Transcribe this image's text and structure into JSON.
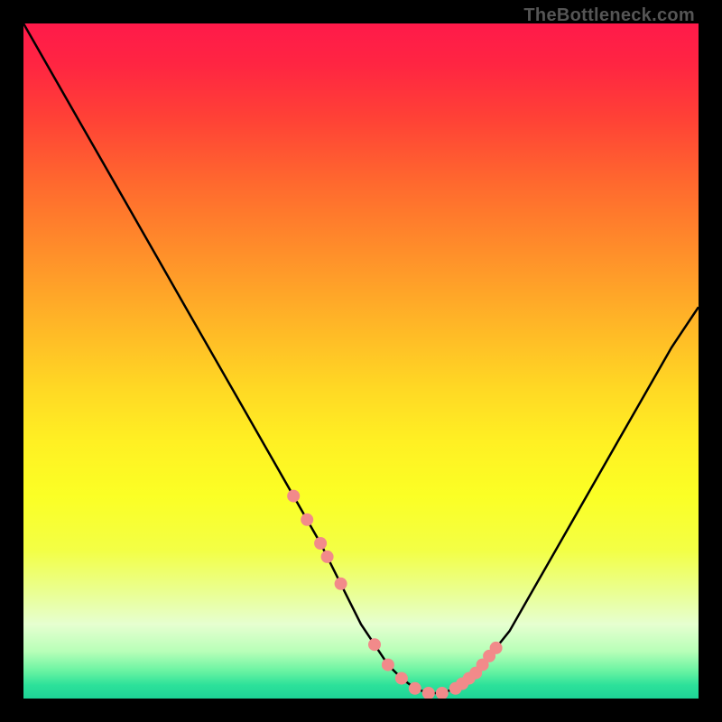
{
  "watermark": "TheBottleneck.com",
  "colors": {
    "background": "#000000",
    "curve": "#000000",
    "marker": "#f28a8a",
    "gradient_top": "#ff1a4a",
    "gradient_bottom": "#1dd396"
  },
  "chart_data": {
    "type": "line",
    "title": "",
    "xlabel": "",
    "ylabel": "",
    "xlim": [
      0,
      100
    ],
    "ylim": [
      0,
      100
    ],
    "x": [
      0,
      4,
      8,
      12,
      16,
      20,
      24,
      28,
      32,
      36,
      40,
      44,
      48,
      50,
      52,
      54,
      56,
      58,
      60,
      62,
      64,
      66,
      68,
      72,
      76,
      80,
      84,
      88,
      92,
      96,
      100
    ],
    "y": [
      100,
      93,
      86,
      79,
      72,
      65,
      58,
      51,
      44,
      37,
      30,
      23,
      15,
      11,
      8,
      5,
      3,
      1.5,
      0.8,
      0.8,
      1.5,
      3,
      5,
      10,
      17,
      24,
      31,
      38,
      45,
      52,
      58
    ],
    "markers": {
      "x": [
        40,
        42,
        44,
        45,
        47,
        52,
        54,
        56,
        58,
        60,
        62,
        64,
        65,
        66,
        67,
        68,
        69,
        70
      ],
      "y": [
        30,
        26.5,
        23,
        21,
        17,
        8,
        5,
        3,
        1.5,
        0.8,
        0.8,
        1.5,
        2.2,
        3,
        3.8,
        5,
        6.3,
        7.5
      ]
    }
  }
}
